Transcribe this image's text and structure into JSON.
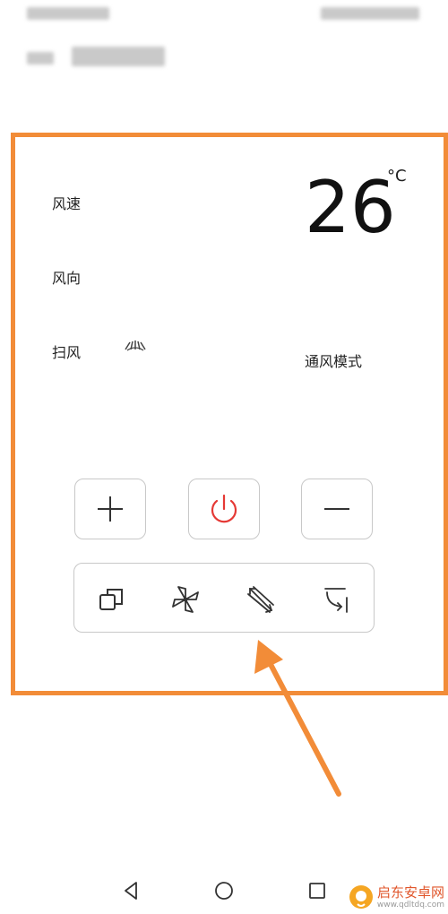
{
  "colors": {
    "accent": "#f28c38",
    "power": "#e53935",
    "icon": "#333333"
  },
  "panel": {
    "labels": {
      "fan_speed": "风速",
      "wind_direction": "风向",
      "swing": "扫风"
    },
    "mode_label": "通风模式",
    "temperature": "26",
    "unit": "°C"
  },
  "controls": {
    "buttons": [
      {
        "name": "increase",
        "icon": "plus-icon"
      },
      {
        "name": "power",
        "icon": "power-icon"
      },
      {
        "name": "decrease",
        "icon": "minus-icon"
      }
    ],
    "modes": [
      {
        "name": "mode-copy",
        "icon": "copy-icon"
      },
      {
        "name": "mode-fan",
        "icon": "fan-icon"
      },
      {
        "name": "mode-swing",
        "icon": "swing-arrows-icon"
      },
      {
        "name": "mode-rotate",
        "icon": "rotate-icon"
      }
    ]
  },
  "navbar": {
    "icons": [
      "back-icon",
      "home-icon",
      "recent-apps-icon"
    ]
  },
  "watermark": {
    "text": "启东安卓网",
    "url": "www.qdltdq.com"
  }
}
